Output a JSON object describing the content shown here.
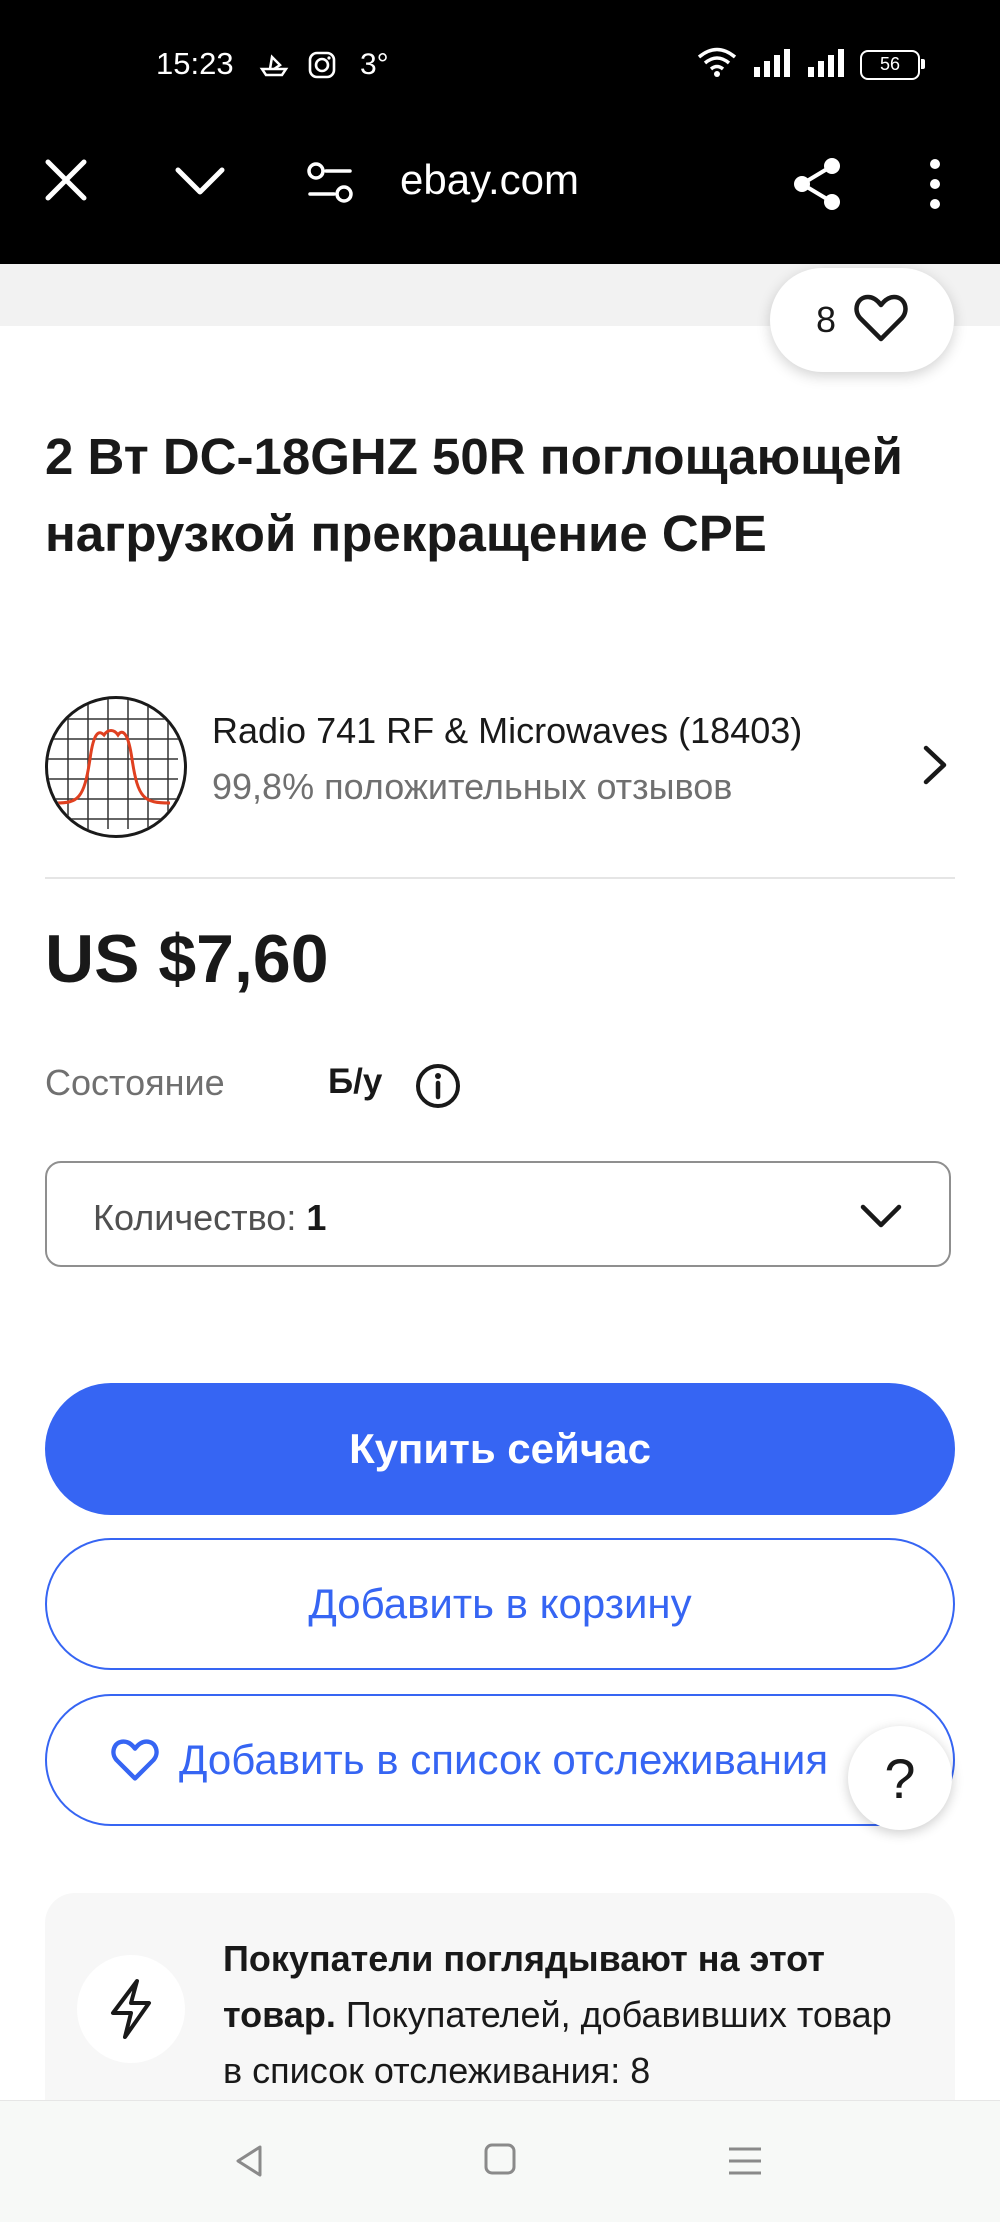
{
  "status_bar": {
    "time": "15:23",
    "temperature": "3°",
    "battery": "56",
    "icons": [
      "boat-icon",
      "instagram-icon",
      "wifi-icon",
      "signal-icon",
      "signal-icon",
      "battery-icon"
    ]
  },
  "browser": {
    "url": "ebay.com",
    "icons": [
      "close-icon",
      "chevron-down-icon",
      "tune-icon",
      "share-icon",
      "more-vert-icon"
    ]
  },
  "watch": {
    "count": "8"
  },
  "product": {
    "title": "2 Вт DC-18GHZ 50R поглощающей нагрузкой прекращение CPE",
    "price": "US $7,60",
    "condition_label": "Состояние",
    "condition_value": "Б/у"
  },
  "seller": {
    "name": "Radio 741 RF & Microwaves (18403)",
    "feedback": "99,8% положительных отзывов"
  },
  "quantity": {
    "label": "Количество: ",
    "value": "1"
  },
  "buttons": {
    "buy_now": "Купить сейчас",
    "add_to_cart": "Добавить в корзину",
    "add_to_watchlist": "Добавить в список отслеживания",
    "help": "?"
  },
  "promo": {
    "bold": "Покупатели поглядывают на этот товар.",
    "text": " Покупателей, добавивших товар в список отслеживания: 8"
  },
  "colors": {
    "accent": "#3665f3",
    "text": "#191919",
    "muted": "#707070"
  }
}
